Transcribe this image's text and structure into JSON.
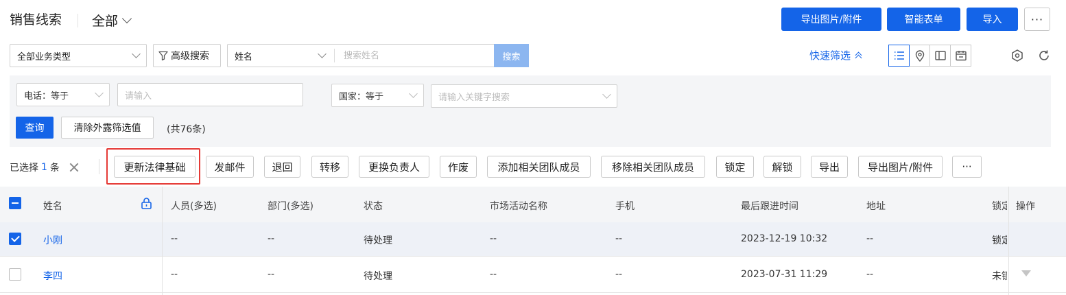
{
  "header": {
    "title": "销售线索",
    "view": "全部",
    "buttons": {
      "export_images": "导出图片/附件",
      "smart_form": "智能表单",
      "import": "导入",
      "more": "···"
    }
  },
  "search": {
    "business_type": "全部业务类型",
    "advanced": "高级搜索",
    "field": "姓名",
    "placeholder": "搜索姓名",
    "button": "搜索"
  },
  "quick_filter": {
    "label": "快速筛选"
  },
  "filters": {
    "phone_label": "电话：等于",
    "phone_placeholder": "请输入",
    "country_label": "国家：等于",
    "country_placeholder": "请输入关键字搜索",
    "query": "查询",
    "clear": "清除外露筛选值",
    "total": "(共76条)"
  },
  "selection": {
    "prefix": "已选择",
    "count": "1",
    "suffix": "条"
  },
  "actions": [
    "更新法律基础",
    "发邮件",
    "退回",
    "转移",
    "更换负责人",
    "作废",
    "添加相关团队成员",
    "移除相关团队成员",
    "锁定",
    "解锁",
    "导出",
    "导出图片/附件",
    "···"
  ],
  "table": {
    "columns": [
      "姓名",
      "人员(多选)",
      "部门(多选)",
      "状态",
      "市场活动名称",
      "手机",
      "最后跟进时间",
      "地址",
      "锁定",
      "操作"
    ],
    "rows": [
      {
        "name": "小刚",
        "people": "--",
        "dept": "--",
        "status": "待处理",
        "campaign": "--",
        "mobile": "--",
        "last_follow": "2023-12-19 10:32",
        "address": "--",
        "lock": "锁定",
        "checked": true
      },
      {
        "name": "李四",
        "people": "--",
        "dept": "--",
        "status": "待处理",
        "campaign": "--",
        "mobile": "--",
        "last_follow": "2023-07-31 11:29",
        "address": "--",
        "lock": "未锁",
        "checked": false
      }
    ]
  },
  "colors": {
    "primary": "#1464e8",
    "highlight": "#e53935",
    "search_button": "#8cb6f0"
  }
}
